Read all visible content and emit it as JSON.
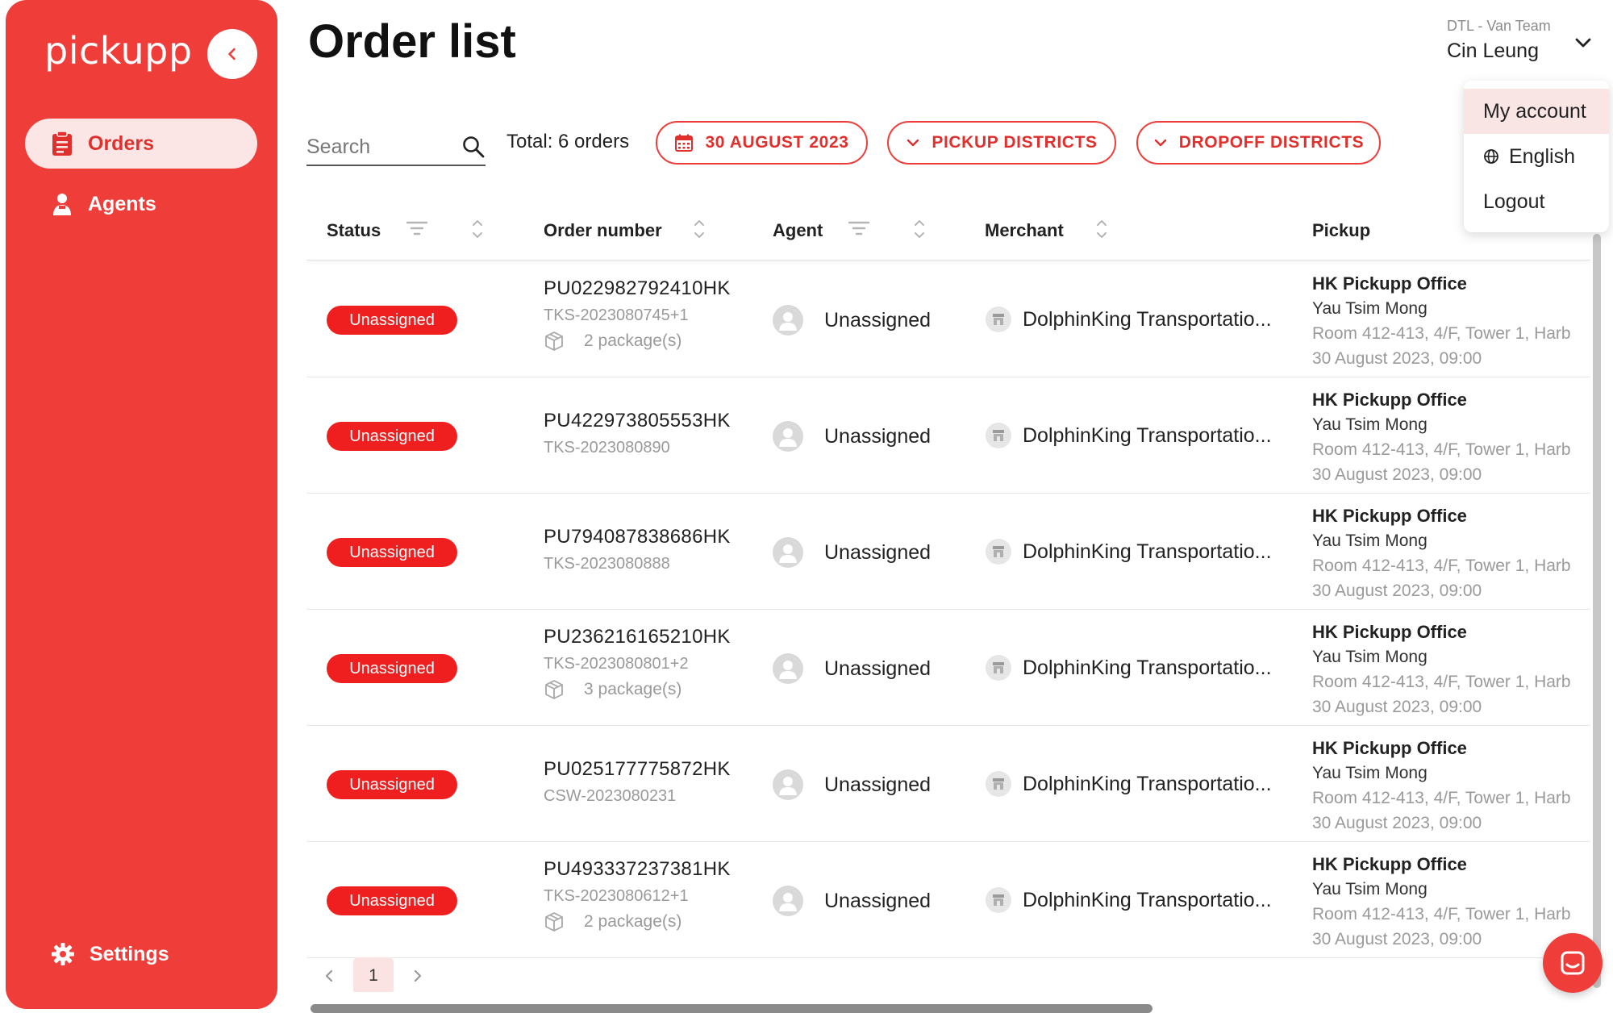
{
  "sidebar": {
    "logo": "pickupp",
    "nav": [
      {
        "label": "Orders",
        "icon": "clipboard-icon",
        "active": true
      },
      {
        "label": "Agents",
        "icon": "agent-icon",
        "active": false
      }
    ],
    "settings_label": "Settings"
  },
  "header": {
    "title": "Order list",
    "team": "DTL - Van Team",
    "user": "Cin Leung"
  },
  "account_menu": {
    "items": [
      {
        "label": "My account",
        "active": true
      },
      {
        "label": "English",
        "icon": "globe-icon"
      },
      {
        "label": "Logout"
      }
    ]
  },
  "filters": {
    "search_placeholder": "Search",
    "total": "Total: 6 orders",
    "date": "30 AUGUST 2023",
    "pickup_districts": "PICKUP DISTRICTS",
    "dropoff_districts": "DROPOFF DISTRICTS"
  },
  "table": {
    "columns": {
      "status": "Status",
      "order_number": "Order number",
      "agent": "Agent",
      "merchant": "Merchant",
      "pickup": "Pickup"
    },
    "rows": [
      {
        "status": "Unassigned",
        "order_no": "PU022982792410HK",
        "ref": "TKS-2023080745+1",
        "packages": "2 package(s)",
        "agent": "Unassigned",
        "merchant": "DolphinKing Transportatio...",
        "pickup_name": "HK Pickupp Office",
        "pickup_district": "Yau Tsim Mong",
        "pickup_address": "Room 412-413, 4/F, Tower 1, Harb",
        "pickup_time": "30 August 2023, 09:00"
      },
      {
        "status": "Unassigned",
        "order_no": "PU422973805553HK",
        "ref": "TKS-2023080890",
        "packages": "",
        "agent": "Unassigned",
        "merchant": "DolphinKing Transportatio...",
        "pickup_name": "HK Pickupp Office",
        "pickup_district": "Yau Tsim Mong",
        "pickup_address": "Room 412-413, 4/F, Tower 1, Harb",
        "pickup_time": "30 August 2023, 09:00"
      },
      {
        "status": "Unassigned",
        "order_no": "PU794087838686HK",
        "ref": "TKS-2023080888",
        "packages": "",
        "agent": "Unassigned",
        "merchant": "DolphinKing Transportatio...",
        "pickup_name": "HK Pickupp Office",
        "pickup_district": "Yau Tsim Mong",
        "pickup_address": "Room 412-413, 4/F, Tower 1, Harb",
        "pickup_time": "30 August 2023, 09:00"
      },
      {
        "status": "Unassigned",
        "order_no": "PU236216165210HK",
        "ref": "TKS-2023080801+2",
        "packages": "3 package(s)",
        "agent": "Unassigned",
        "merchant": "DolphinKing Transportatio...",
        "pickup_name": "HK Pickupp Office",
        "pickup_district": "Yau Tsim Mong",
        "pickup_address": "Room 412-413, 4/F, Tower 1, Harb",
        "pickup_time": "30 August 2023, 09:00"
      },
      {
        "status": "Unassigned",
        "order_no": "PU025177775872HK",
        "ref": "CSW-2023080231",
        "packages": "",
        "agent": "Unassigned",
        "merchant": "DolphinKing Transportatio...",
        "pickup_name": "HK Pickupp Office",
        "pickup_district": "Yau Tsim Mong",
        "pickup_address": "Room 412-413, 4/F, Tower 1, Harb",
        "pickup_time": "30 August 2023, 09:00"
      },
      {
        "status": "Unassigned",
        "order_no": "PU493337237381HK",
        "ref": "TKS-2023080612+1",
        "packages": "2 package(s)",
        "agent": "Unassigned",
        "merchant": "DolphinKing Transportatio...",
        "pickup_name": "HK Pickupp Office",
        "pickup_district": "Yau Tsim Mong",
        "pickup_address": "Room 412-413, 4/F, Tower 1, Harb",
        "pickup_time": "30 August 2023, 09:00"
      }
    ]
  },
  "pagination": {
    "current": "1"
  },
  "colors": {
    "brand": "#ef3d3a",
    "badge": "#f01f1f"
  }
}
